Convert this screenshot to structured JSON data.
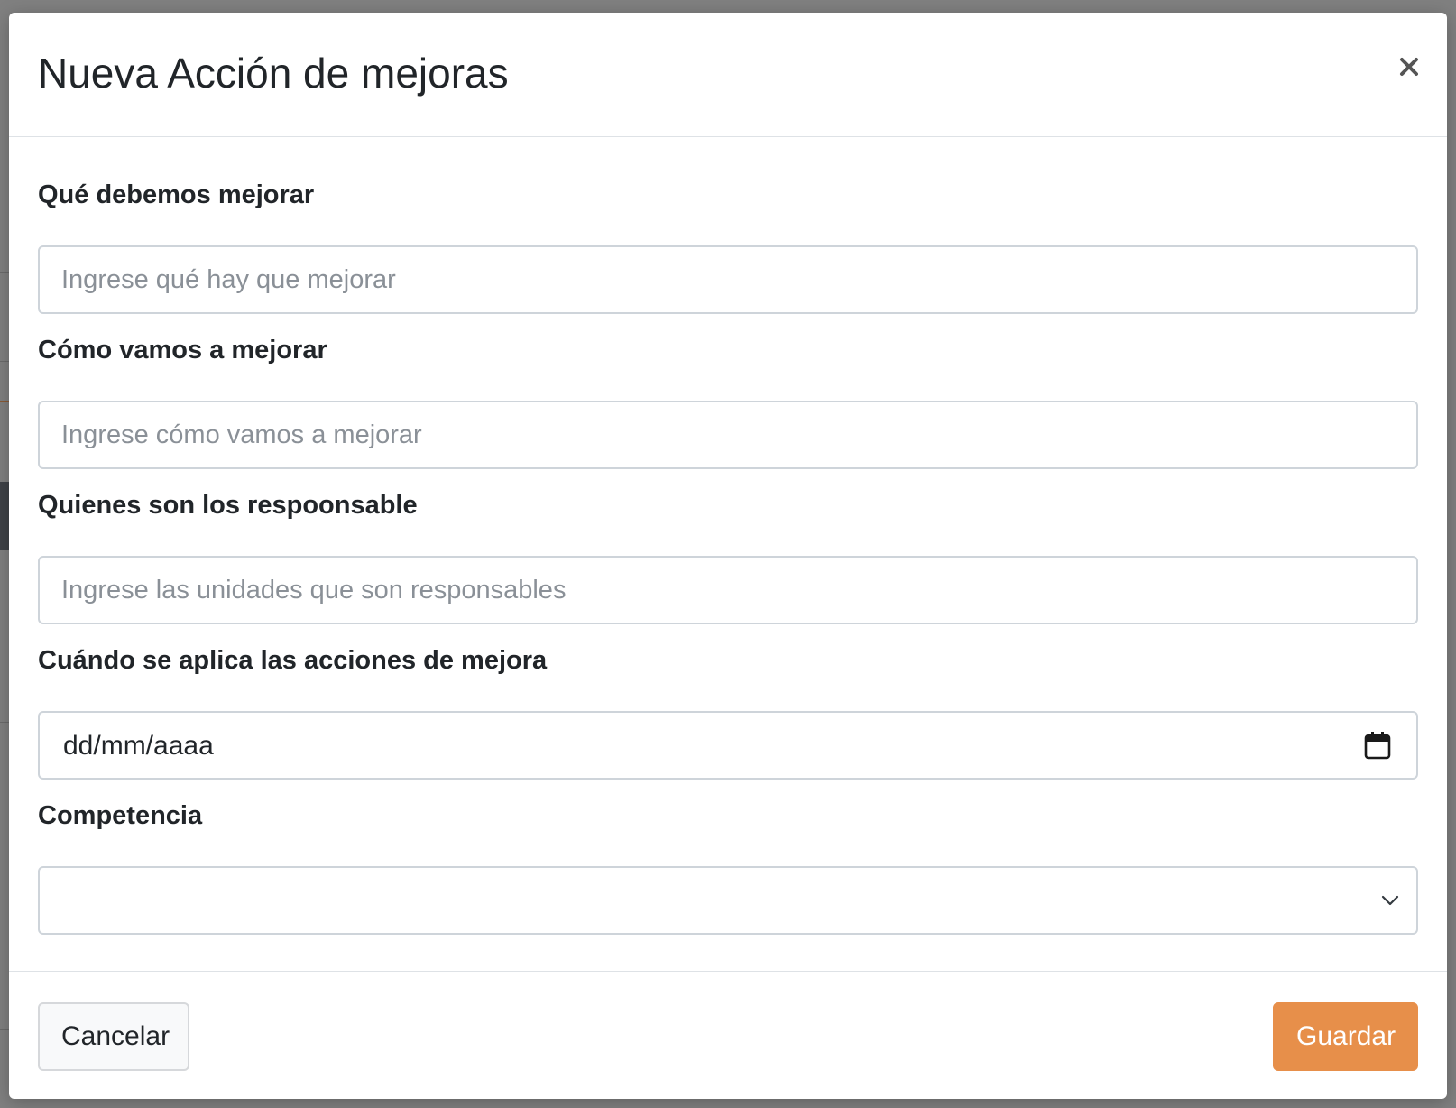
{
  "modal": {
    "title": "Nueva Acción de mejoras",
    "close_label": "×"
  },
  "form": {
    "improve": {
      "label": "Qué debemos mejorar",
      "placeholder": "Ingrese qué hay que mejorar"
    },
    "how": {
      "label": "Cómo vamos a mejorar",
      "placeholder": "Ingrese cómo vamos a mejorar"
    },
    "responsible": {
      "label": "Quienes son los respoonsable",
      "placeholder": "Ingrese las unidades que son responsables"
    },
    "when": {
      "label": "Cuándo se aplica las acciones de mejora",
      "value": "dd/mm/aaaa"
    },
    "competence": {
      "label": "Competencia",
      "selected": ""
    }
  },
  "footer": {
    "cancel_label": "Cancelar",
    "save_label": "Guardar"
  },
  "colors": {
    "primary": "#e78f4a",
    "overlay": "#808080",
    "border": "#ced4da"
  },
  "icons": {
    "close": "close-icon",
    "date": "calendar-icon",
    "select": "chevron-down-icon"
  }
}
